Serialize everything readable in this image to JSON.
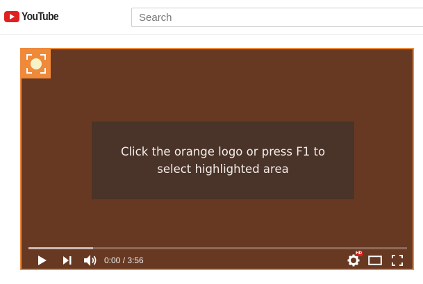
{
  "header": {
    "logo_text": "YouTube",
    "search_placeholder": "Search"
  },
  "player": {
    "message": "Click the orange logo or press F1 to select highlighted area",
    "time_display": "0:00 / 3:56",
    "hd_badge": "HD",
    "progress_loaded_fraction": 0.17,
    "accent_color": "#ef8a3a",
    "overlay_color": "#673922"
  },
  "icons": {
    "logo": "youtube-play-icon",
    "selector": "screen-selector-icon",
    "play": "play-icon",
    "next": "skip-next-icon",
    "volume": "volume-icon",
    "settings": "gear-icon",
    "theater": "theater-mode-icon",
    "fullscreen": "fullscreen-icon"
  }
}
